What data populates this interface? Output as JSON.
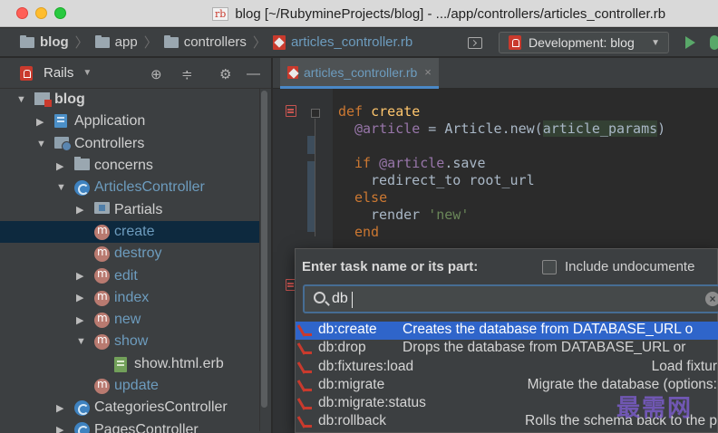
{
  "window": {
    "title": "blog [~/RubymineProjects/blog] - .../app/controllers/articles_controller.rb",
    "file_badge": "rb"
  },
  "navbar": {
    "crumbs": [
      "blog",
      "app",
      "controllers",
      "articles_controller.rb"
    ],
    "run_config": "Development: blog"
  },
  "project_panel": {
    "title": "Rails",
    "tree": [
      {
        "label": "blog",
        "icon": "project-folder-icon",
        "arrow": "▼",
        "indent": 0
      },
      {
        "label": "Application",
        "icon": "application-icon",
        "arrow": "▶",
        "indent": 1
      },
      {
        "label": "Controllers",
        "icon": "controllers-folder-icon",
        "arrow": "▼",
        "indent": 1
      },
      {
        "label": "concerns",
        "icon": "folder-icon",
        "arrow": "▶",
        "indent": 2
      },
      {
        "label": "ArticlesController",
        "icon": "controller-class-icon",
        "arrow": "▼",
        "indent": 2
      },
      {
        "label": "Partials",
        "icon": "partials-folder-icon",
        "arrow": "▶",
        "indent": 3
      },
      {
        "label": "create",
        "icon": "method-icon",
        "arrow": "",
        "indent": 3
      },
      {
        "label": "destroy",
        "icon": "method-icon",
        "arrow": "",
        "indent": 3
      },
      {
        "label": "edit",
        "icon": "method-icon",
        "arrow": "▶",
        "indent": 3
      },
      {
        "label": "index",
        "icon": "method-icon",
        "arrow": "▶",
        "indent": 3
      },
      {
        "label": "new",
        "icon": "method-icon",
        "arrow": "▶",
        "indent": 3
      },
      {
        "label": "show",
        "icon": "method-icon",
        "arrow": "▼",
        "indent": 3
      },
      {
        "label": "show.html.erb",
        "icon": "erb-file-icon",
        "arrow": "",
        "indent": 4
      },
      {
        "label": "update",
        "icon": "method-icon",
        "arrow": "",
        "indent": 3
      },
      {
        "label": "CategoriesController",
        "icon": "controller-class-icon",
        "arrow": "▶",
        "indent": 2
      },
      {
        "label": "PagesController",
        "icon": "controller-class-icon",
        "arrow": "▶",
        "indent": 2
      }
    ],
    "selected_index": 6
  },
  "editor": {
    "tab_label": "articles_controller.rb",
    "tab_close": "×",
    "code": {
      "l1_kw": "def",
      "l1_name": "create",
      "l2_ivar": "@article",
      "l2_eq": " = ",
      "l2_cls": "Article",
      "l2_dot": ".",
      "l2_new": "new(",
      "l2_param": "article_params",
      "l2_close": ")",
      "l4_kw": "if",
      "l4_ivar": "@article",
      "l4_save": ".save",
      "l5_call": "redirect_to",
      "l5_arg": " root_url",
      "l6_kw": "else",
      "l7_call": "render",
      "l7_str": "'new'",
      "l8_kw": "end"
    }
  },
  "popup": {
    "title": "Enter task name or its part:",
    "checkbox_label": "Include undocumente",
    "search_value": "db",
    "results": [
      {
        "name": "db:create",
        "desc": "Creates the database from DATABASE_URL o"
      },
      {
        "name": "db:drop",
        "desc": "Drops the database from DATABASE_URL or"
      },
      {
        "name": "db:fixtures:load",
        "desc": "Load fixtur"
      },
      {
        "name": "db:migrate",
        "desc": "Migrate the database (options:"
      },
      {
        "name": "db:migrate:status",
        "desc": ""
      },
      {
        "name": "db:rollback",
        "desc": "Rolls the schema back to the p"
      }
    ]
  },
  "watermark": "最需网",
  "colors": {
    "selection_blue": "#2f65ca",
    "keyword": "#cc7832",
    "instance_var": "#9876aa",
    "method_name": "#ffc66d",
    "string": "#6a8759",
    "ruby_red": "#c93a2d"
  }
}
